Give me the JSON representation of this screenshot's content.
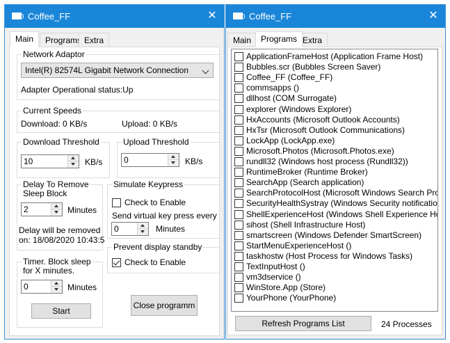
{
  "left_window": {
    "title": "Coffee_FF",
    "tabs": [
      "Main",
      "Programs",
      "Extra"
    ],
    "network": {
      "group_title": "Network Adaptor",
      "adapter_selected": "Intel(R) 82574L Gigabit Network Connection",
      "status": "Adapter Operational status:Up"
    },
    "speeds": {
      "group_title": "Current Speeds",
      "download": "Download: 0 KB/s",
      "upload": "Upload: 0 KB/s"
    },
    "download_threshold": {
      "group_title": "Download Threshold",
      "value": "10",
      "unit": "KB/s"
    },
    "upload_threshold": {
      "group_title": "Upload Threshold",
      "value": "0",
      "unit": "KB/s"
    },
    "delay_remove": {
      "group_title_1": "Delay To Remove",
      "group_title_2": "Sleep Block",
      "value": "2",
      "unit": "Minutes",
      "info_1": "Delay will be removed",
      "info_2": "on: 18/08/2020 10:43:5"
    },
    "simulate": {
      "group_title": "Simulate Keypress",
      "check_label": "Check to Enable",
      "checked": false,
      "send_label": "Send virtual key press every",
      "value": "0",
      "unit": "Minutes"
    },
    "prevent": {
      "group_title": "Prevent display standby",
      "check_label": "Check to Enable",
      "checked": true
    },
    "timer": {
      "group_title_1": "Timer. Block sleep",
      "group_title_2": "for X minutes.",
      "value": "0",
      "unit": "Minutes",
      "start_label": "Start"
    },
    "close_label": "Close programm"
  },
  "right_window": {
    "title": "Coffee_FF",
    "tabs": [
      "Main",
      "Programs",
      "Extra"
    ],
    "programs": [
      "ApplicationFrameHost (Application Frame Host)",
      "Bubbles.scr (Bubbles Screen Saver)",
      "Coffee_FF (Coffee_FF)",
      "commsapps ()",
      "dllhost (COM Surrogate)",
      "explorer (Windows Explorer)",
      "HxAccounts (Microsoft Outlook Accounts)",
      "HxTsr (Microsoft Outlook Communications)",
      "LockApp (LockApp.exe)",
      "Microsoft.Photos (Microsoft.Photos.exe)",
      "rundll32 (Windows host process (Rundll32))",
      "RuntimeBroker (Runtime Broker)",
      "SearchApp (Search application)",
      "SearchProtocolHost (Microsoft Windows Search Protocol",
      "SecurityHealthSystray (Windows Security notification icon)",
      "ShellExperienceHost (Windows Shell Experience Host)",
      "sihost (Shell Infrastructure Host)",
      "smartscreen (Windows Defender SmartScreen)",
      "StartMenuExperienceHost ()",
      "taskhostw (Host Process for Windows Tasks)",
      "TextInputHost ()",
      "vm3dservice ()",
      "WinStore.App (Store)",
      "YourPhone (YourPhone)"
    ],
    "refresh_label": "Refresh Programs List",
    "process_count": "24 Processes"
  },
  "colors": {
    "titlebar": "#1a86d9",
    "window_bg": "#f0f0f0",
    "border": "#3a8fd6"
  }
}
